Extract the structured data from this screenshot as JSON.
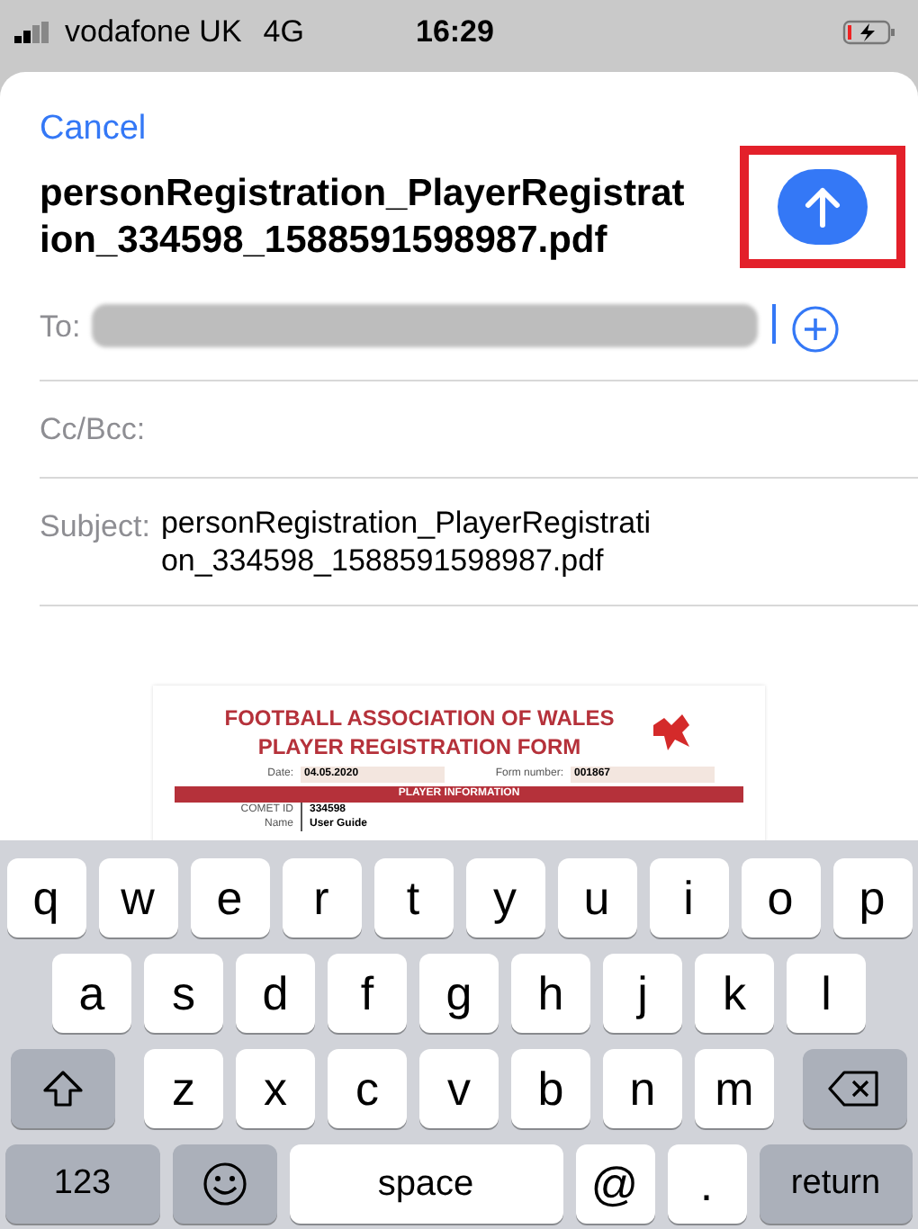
{
  "status_bar": {
    "carrier": "vodafone UK",
    "network": "4G",
    "time": "16:29"
  },
  "compose": {
    "cancel": "Cancel",
    "title": "personRegistration_PlayerRegistration_334598_1588591598987.pdf",
    "fields": [
      {
        "label": "To:",
        "kind": "recipients"
      },
      {
        "label": "Cc/Bcc:",
        "kind": "empty"
      },
      {
        "label": "Subject:",
        "kind": "text",
        "value": "personRegistration_PlayerRegistration_334598_1588591598987.pdf"
      }
    ]
  },
  "attachment": {
    "heading": [
      "FOOTBALL ASSOCIATION OF WALES",
      "PLAYER REGISTRATION FORM"
    ],
    "date_label": "Date:",
    "date": "04.05.2020",
    "form_label": "Form number:",
    "form_number": "001867",
    "section": "PLAYER INFORMATION",
    "rows": [
      {
        "label": "COMET ID",
        "value": "334598"
      },
      {
        "label": "Name",
        "value": "User Guide"
      }
    ]
  },
  "keyboard": {
    "rows": [
      {
        "keys": [
          {
            "kind": "char",
            "label": "q"
          },
          {
            "kind": "char",
            "label": "w"
          },
          {
            "kind": "char",
            "label": "e"
          },
          {
            "kind": "char",
            "label": "r"
          },
          {
            "kind": "char",
            "label": "t"
          },
          {
            "kind": "char",
            "label": "y"
          },
          {
            "kind": "char",
            "label": "u"
          },
          {
            "kind": "char",
            "label": "i"
          },
          {
            "kind": "char",
            "label": "o"
          },
          {
            "kind": "char",
            "label": "p"
          }
        ]
      },
      {
        "keys": [
          {
            "kind": "char",
            "label": "a"
          },
          {
            "kind": "char",
            "label": "s"
          },
          {
            "kind": "char",
            "label": "d"
          },
          {
            "kind": "char",
            "label": "f"
          },
          {
            "kind": "char",
            "label": "g"
          },
          {
            "kind": "char",
            "label": "h"
          },
          {
            "kind": "char",
            "label": "j"
          },
          {
            "kind": "char",
            "label": "k"
          },
          {
            "kind": "char",
            "label": "l"
          }
        ]
      },
      {
        "keys": [
          {
            "kind": "shift"
          },
          {
            "kind": "char",
            "label": "z"
          },
          {
            "kind": "char",
            "label": "x"
          },
          {
            "kind": "char",
            "label": "c"
          },
          {
            "kind": "char",
            "label": "v"
          },
          {
            "kind": "char",
            "label": "b"
          },
          {
            "kind": "char",
            "label": "n"
          },
          {
            "kind": "char",
            "label": "m"
          },
          {
            "kind": "backspace"
          }
        ]
      },
      {
        "keys": [
          {
            "kind": "mode",
            "label": "123"
          },
          {
            "kind": "emoji"
          },
          {
            "kind": "space",
            "label": "space"
          },
          {
            "kind": "char",
            "label": "@"
          },
          {
            "kind": "char",
            "label": "."
          },
          {
            "kind": "mode",
            "label": "return"
          }
        ]
      }
    ]
  }
}
